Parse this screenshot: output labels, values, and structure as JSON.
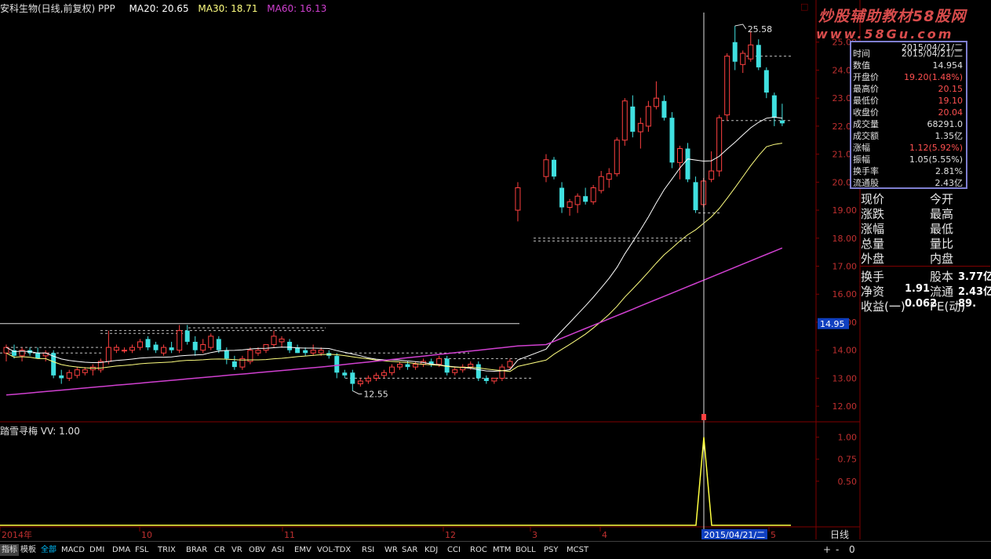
{
  "header": {
    "stock": "安科生物(日线,前复权) PPP",
    "ma20": "MA20: 20.65",
    "ma30": "MA30: 18.71",
    "ma60": "MA60: 16.13",
    "corner": "□"
  },
  "watermark": {
    "line1": "炒股辅助教材58股网",
    "line2": "www.58Gu.com"
  },
  "price_axis": {
    "labels": [
      "25.00",
      "24.00",
      "23.00",
      "22.00",
      "21.00",
      "20.00",
      "19.00",
      "18.00",
      "17.00",
      "16.00",
      "15.00",
      "14.00",
      "13.00",
      "12.00"
    ],
    "current": "14.95"
  },
  "annotations": {
    "high": "25.58",
    "low": "12.55"
  },
  "sub_panel": {
    "title": "踏雪寻梅 VV: 1.00",
    "axis_labels": [
      "1.00",
      "0.75",
      "0.50"
    ]
  },
  "time_axis": {
    "labels": [
      "2014年",
      "10",
      "11",
      "12",
      "3",
      "4",
      "5"
    ],
    "cursor_date": "2015/04/21/二",
    "period": "日线"
  },
  "info_box": {
    "title": "2015/04/21/二",
    "rows": [
      {
        "key": "时间",
        "value": "2015/04/21/二",
        "color": "#e0e0e0"
      },
      {
        "key": "数值",
        "value": "14.954",
        "color": "#e0e0e0"
      },
      {
        "key": "开盘价",
        "value": "19.20(1.48%)",
        "color": "#ff5050"
      },
      {
        "key": "最高价",
        "value": "20.15",
        "color": "#ff5050"
      },
      {
        "key": "最低价",
        "value": "19.10",
        "color": "#ff5050"
      },
      {
        "key": "收盘价",
        "value": "20.04",
        "color": "#ff5050"
      },
      {
        "key": "成交量",
        "value": "68291.0",
        "color": "#e0e0e0"
      },
      {
        "key": "成交额",
        "value": "1.35亿",
        "color": "#e0e0e0"
      },
      {
        "key": "涨幅",
        "value": "1.12(5.92%)",
        "color": "#ff5050"
      },
      {
        "key": "振幅",
        "value": "1.05(5.55%)",
        "color": "#e0e0e0"
      },
      {
        "key": "换手率",
        "value": "2.81%",
        "color": "#e0e0e0"
      },
      {
        "key": "流通股",
        "value": "2.43亿",
        "color": "#e0e0e0"
      }
    ]
  },
  "quote_panel": {
    "rows": [
      [
        "现价",
        "今开"
      ],
      [
        "涨跌",
        "最高"
      ],
      [
        "涨幅",
        "最低"
      ],
      [
        "总量",
        "量比"
      ],
      [
        "外盘",
        "内盘"
      ]
    ],
    "stats": [
      {
        "k1": "换手",
        "v1": "",
        "k2": "股本",
        "v2": "3.77亿"
      },
      {
        "k1": "净资",
        "v1": "1.91",
        "k2": "流通",
        "v2": "2.43亿"
      },
      {
        "k1": "收益(一)",
        "v1": "0.062",
        "k2": "PE(动)",
        "v2": "89."
      }
    ]
  },
  "tabs": [
    "指标",
    "模板",
    "全部",
    "MACD",
    "DMI",
    "DMA",
    "FSL",
    "TRIX",
    "BRAR",
    "CR",
    "VR",
    "OBV",
    "ASI",
    "EMV",
    "VOL-TDX",
    "RSI",
    "WR",
    "SAR",
    "KDJ",
    "CCI",
    "ROC",
    "MTM",
    "BOLL",
    "PSY",
    "MCST"
  ],
  "tab_controls": {
    "plus": "+",
    "minus": "-",
    "zero": "0"
  },
  "colors": {
    "up": "#ff4040",
    "down": "#40e0e0",
    "ma20": "#ffffff",
    "ma30": "#ffff80",
    "ma60": "#d040d0",
    "signal": "#ffff40",
    "grid": "#800000"
  },
  "chart_data": {
    "type": "candlestick",
    "price_range": [
      11.5,
      26.0
    ],
    "candles": [
      {
        "o": 13.9,
        "h": 14.2,
        "l": 13.6,
        "c": 14.1
      },
      {
        "o": 14.0,
        "h": 14.2,
        "l": 13.7,
        "c": 13.8
      },
      {
        "o": 13.8,
        "h": 14.1,
        "l": 13.6,
        "c": 14.0
      },
      {
        "o": 14.0,
        "h": 14.1,
        "l": 13.8,
        "c": 13.9
      },
      {
        "o": 13.9,
        "h": 14.1,
        "l": 13.7,
        "c": 13.7
      },
      {
        "o": 13.8,
        "h": 14.0,
        "l": 13.6,
        "c": 13.9
      },
      {
        "o": 13.9,
        "h": 14.0,
        "l": 13.0,
        "c": 13.1
      },
      {
        "o": 13.1,
        "h": 13.3,
        "l": 12.8,
        "c": 13.0
      },
      {
        "o": 13.0,
        "h": 13.3,
        "l": 12.9,
        "c": 13.2
      },
      {
        "o": 13.1,
        "h": 13.4,
        "l": 13.0,
        "c": 13.3
      },
      {
        "o": 13.2,
        "h": 13.4,
        "l": 13.1,
        "c": 13.3
      },
      {
        "o": 13.3,
        "h": 13.5,
        "l": 13.1,
        "c": 13.4
      },
      {
        "o": 13.3,
        "h": 13.7,
        "l": 13.2,
        "c": 13.6
      },
      {
        "o": 13.6,
        "h": 14.7,
        "l": 13.5,
        "c": 14.1
      },
      {
        "o": 14.0,
        "h": 14.2,
        "l": 13.9,
        "c": 14.1
      },
      {
        "o": 14.0,
        "h": 14.1,
        "l": 13.9,
        "c": 14.0
      },
      {
        "o": 14.0,
        "h": 14.2,
        "l": 13.9,
        "c": 14.1
      },
      {
        "o": 14.1,
        "h": 14.4,
        "l": 14.0,
        "c": 14.3
      },
      {
        "o": 14.4,
        "h": 14.5,
        "l": 14.0,
        "c": 14.1
      },
      {
        "o": 14.2,
        "h": 14.3,
        "l": 13.9,
        "c": 14.0
      },
      {
        "o": 13.9,
        "h": 14.2,
        "l": 13.8,
        "c": 14.1
      },
      {
        "o": 14.1,
        "h": 14.3,
        "l": 13.9,
        "c": 14.0
      },
      {
        "o": 14.0,
        "h": 14.9,
        "l": 13.9,
        "c": 14.7
      },
      {
        "o": 14.7,
        "h": 14.9,
        "l": 14.2,
        "c": 14.3
      },
      {
        "o": 14.3,
        "h": 14.5,
        "l": 13.8,
        "c": 14.0
      },
      {
        "o": 14.0,
        "h": 14.4,
        "l": 13.9,
        "c": 14.2
      },
      {
        "o": 14.1,
        "h": 14.6,
        "l": 14.0,
        "c": 14.5
      },
      {
        "o": 14.4,
        "h": 14.5,
        "l": 13.9,
        "c": 14.0
      },
      {
        "o": 14.0,
        "h": 14.1,
        "l": 13.5,
        "c": 13.7
      },
      {
        "o": 13.6,
        "h": 13.8,
        "l": 13.3,
        "c": 13.4
      },
      {
        "o": 13.4,
        "h": 13.8,
        "l": 13.3,
        "c": 13.7
      },
      {
        "o": 13.6,
        "h": 14.1,
        "l": 13.5,
        "c": 14.0
      },
      {
        "o": 13.9,
        "h": 14.1,
        "l": 13.8,
        "c": 14.0
      },
      {
        "o": 14.0,
        "h": 14.2,
        "l": 13.9,
        "c": 14.2
      },
      {
        "o": 14.2,
        "h": 14.7,
        "l": 14.1,
        "c": 14.5
      },
      {
        "o": 14.3,
        "h": 14.5,
        "l": 14.1,
        "c": 14.4
      },
      {
        "o": 14.3,
        "h": 14.4,
        "l": 13.9,
        "c": 14.0
      },
      {
        "o": 14.1,
        "h": 14.2,
        "l": 13.9,
        "c": 13.9
      },
      {
        "o": 14.0,
        "h": 14.1,
        "l": 13.8,
        "c": 13.9
      },
      {
        "o": 13.9,
        "h": 14.2,
        "l": 13.8,
        "c": 14.0
      },
      {
        "o": 13.9,
        "h": 14.1,
        "l": 13.8,
        "c": 14.0
      },
      {
        "o": 13.9,
        "h": 14.0,
        "l": 13.7,
        "c": 13.8
      },
      {
        "o": 13.8,
        "h": 13.9,
        "l": 13.0,
        "c": 13.2
      },
      {
        "o": 13.2,
        "h": 13.3,
        "l": 13.0,
        "c": 13.1
      },
      {
        "o": 13.2,
        "h": 13.3,
        "l": 12.55,
        "c": 12.8
      },
      {
        "o": 12.8,
        "h": 13.0,
        "l": 12.7,
        "c": 12.9
      },
      {
        "o": 12.9,
        "h": 13.1,
        "l": 12.8,
        "c": 13.0
      },
      {
        "o": 13.0,
        "h": 13.2,
        "l": 12.9,
        "c": 13.1
      },
      {
        "o": 13.1,
        "h": 13.3,
        "l": 13.0,
        "c": 13.2
      },
      {
        "o": 13.2,
        "h": 13.5,
        "l": 13.1,
        "c": 13.4
      },
      {
        "o": 13.4,
        "h": 13.6,
        "l": 13.3,
        "c": 13.5
      },
      {
        "o": 13.5,
        "h": 13.6,
        "l": 13.3,
        "c": 13.4
      },
      {
        "o": 13.4,
        "h": 13.6,
        "l": 13.3,
        "c": 13.5
      },
      {
        "o": 13.5,
        "h": 13.7,
        "l": 13.4,
        "c": 13.6
      },
      {
        "o": 13.6,
        "h": 13.7,
        "l": 13.4,
        "c": 13.5
      },
      {
        "o": 13.5,
        "h": 13.8,
        "l": 13.4,
        "c": 13.7
      },
      {
        "o": 13.7,
        "h": 13.8,
        "l": 13.1,
        "c": 13.2
      },
      {
        "o": 13.2,
        "h": 13.4,
        "l": 13.1,
        "c": 13.3
      },
      {
        "o": 13.3,
        "h": 13.5,
        "l": 13.2,
        "c": 13.4
      },
      {
        "o": 13.4,
        "h": 13.6,
        "l": 13.3,
        "c": 13.5
      },
      {
        "o": 13.5,
        "h": 13.6,
        "l": 12.9,
        "c": 13.0
      },
      {
        "o": 13.0,
        "h": 13.1,
        "l": 12.8,
        "c": 12.9
      },
      {
        "o": 12.9,
        "h": 13.0,
        "l": 12.8,
        "c": 13.0
      },
      {
        "o": 13.0,
        "h": 13.5,
        "l": 12.9,
        "c": 13.4
      },
      {
        "o": 13.4,
        "h": 13.7,
        "l": 13.3,
        "c": 13.6
      },
      {
        "o": 19.0,
        "h": 20.0,
        "l": 18.6,
        "c": 19.8
      },
      {
        "o": 20.2,
        "h": 21.0,
        "l": 20.0,
        "c": 20.8
      },
      {
        "o": 20.8,
        "h": 20.9,
        "l": 20.1,
        "c": 20.2
      },
      {
        "o": 19.8,
        "h": 20.0,
        "l": 18.9,
        "c": 19.1
      },
      {
        "o": 19.1,
        "h": 19.4,
        "l": 18.8,
        "c": 19.3
      },
      {
        "o": 19.2,
        "h": 19.6,
        "l": 18.9,
        "c": 19.5
      },
      {
        "o": 19.5,
        "h": 19.8,
        "l": 19.2,
        "c": 19.3
      },
      {
        "o": 19.3,
        "h": 19.9,
        "l": 19.2,
        "c": 19.8
      },
      {
        "o": 19.7,
        "h": 20.4,
        "l": 19.6,
        "c": 20.2
      },
      {
        "o": 20.1,
        "h": 20.5,
        "l": 19.8,
        "c": 20.3
      },
      {
        "o": 20.3,
        "h": 21.6,
        "l": 20.2,
        "c": 21.5
      },
      {
        "o": 21.5,
        "h": 23.0,
        "l": 21.3,
        "c": 22.9
      },
      {
        "o": 22.7,
        "h": 23.1,
        "l": 21.6,
        "c": 21.8
      },
      {
        "o": 21.8,
        "h": 22.3,
        "l": 21.2,
        "c": 22.1
      },
      {
        "o": 22.0,
        "h": 22.9,
        "l": 21.8,
        "c": 22.7
      },
      {
        "o": 22.7,
        "h": 23.6,
        "l": 22.6,
        "c": 23.0
      },
      {
        "o": 22.9,
        "h": 23.1,
        "l": 22.2,
        "c": 22.3
      },
      {
        "o": 22.3,
        "h": 22.5,
        "l": 20.5,
        "c": 20.7
      },
      {
        "o": 20.7,
        "h": 21.3,
        "l": 20.1,
        "c": 21.2
      },
      {
        "o": 21.2,
        "h": 21.4,
        "l": 20.0,
        "c": 20.1
      },
      {
        "o": 20.0,
        "h": 20.2,
        "l": 18.9,
        "c": 19.0
      },
      {
        "o": 19.2,
        "h": 20.15,
        "l": 19.1,
        "c": 20.04
      },
      {
        "o": 20.1,
        "h": 21.1,
        "l": 20.0,
        "c": 20.4
      },
      {
        "o": 20.4,
        "h": 22.4,
        "l": 20.2,
        "c": 22.3
      },
      {
        "o": 22.4,
        "h": 24.6,
        "l": 22.2,
        "c": 24.5
      },
      {
        "o": 25.0,
        "h": 25.58,
        "l": 24.0,
        "c": 24.3
      },
      {
        "o": 24.2,
        "h": 24.7,
        "l": 23.9,
        "c": 24.6
      },
      {
        "o": 24.4,
        "h": 25.4,
        "l": 24.3,
        "c": 24.9
      },
      {
        "o": 24.9,
        "h": 25.1,
        "l": 24.0,
        "c": 24.1
      },
      {
        "o": 24.0,
        "h": 24.1,
        "l": 23.0,
        "c": 23.2
      },
      {
        "o": 23.1,
        "h": 23.2,
        "l": 22.0,
        "c": 22.3
      },
      {
        "o": 22.2,
        "h": 22.8,
        "l": 22.0,
        "c": 22.1
      }
    ],
    "signal": {
      "index_of_spike": 87,
      "value": 1.0,
      "range": [
        0,
        1.05
      ]
    }
  }
}
